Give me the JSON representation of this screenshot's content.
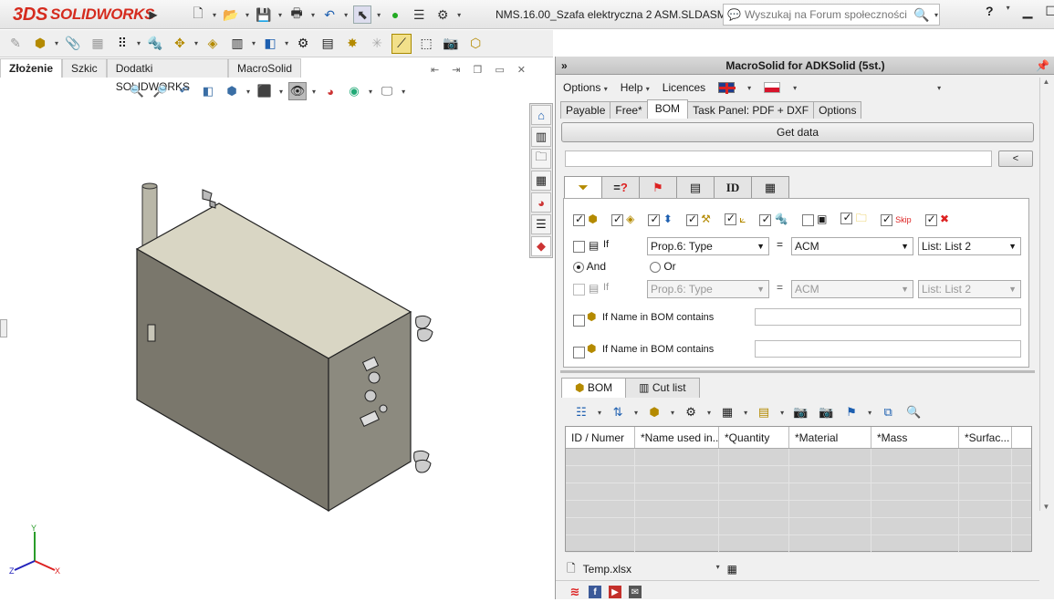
{
  "app": {
    "logo_prefix": "3DS",
    "logo_text": "SOLIDWORKS",
    "document_title": "NMS.16.00_Szafa elektryczna 2 ASM.SLDASM *",
    "search_placeholder": "Wyszukaj na Forum społeczności",
    "help_label": "?"
  },
  "left_tabs": [
    "Złożenie",
    "Szkic",
    "Dodatki SOLIDWORKS",
    "MacroSolid"
  ],
  "triad": {
    "x": "X",
    "y": "Y",
    "z": "Z"
  },
  "panel": {
    "title": "MacroSolid for ADKSolid (5st.)",
    "menu": [
      "Options",
      "Help",
      "Licences"
    ],
    "tabs": [
      "Payable",
      "Free*",
      "BOM",
      "Task Panel: PDF + DXF",
      "Options"
    ],
    "active_tab": "BOM",
    "get_data_label": "Get data",
    "back_label": "<",
    "subtab_id_label": "ID",
    "skip_label": "Skip",
    "filter": {
      "if_label": "If",
      "row1": {
        "field": "Prop.6: Type",
        "op": "=",
        "value": "ACM",
        "list": "List: List 2"
      },
      "and_label": "And",
      "or_label": "Or",
      "row2": {
        "field": "Prop.6: Type",
        "op": "=",
        "value": "ACM",
        "list": "List: List 2"
      },
      "name_contains_1": "If Name in BOM contains",
      "name_contains_2": "If Name in BOM contains"
    },
    "bottom_tabs": [
      "BOM",
      "Cut list"
    ],
    "grid_headers": [
      "ID / Numer",
      "*Name used in...",
      "*Quantity",
      "*Material",
      "*Mass",
      "*Surfac..."
    ],
    "file_name": "Temp.xlsx"
  }
}
